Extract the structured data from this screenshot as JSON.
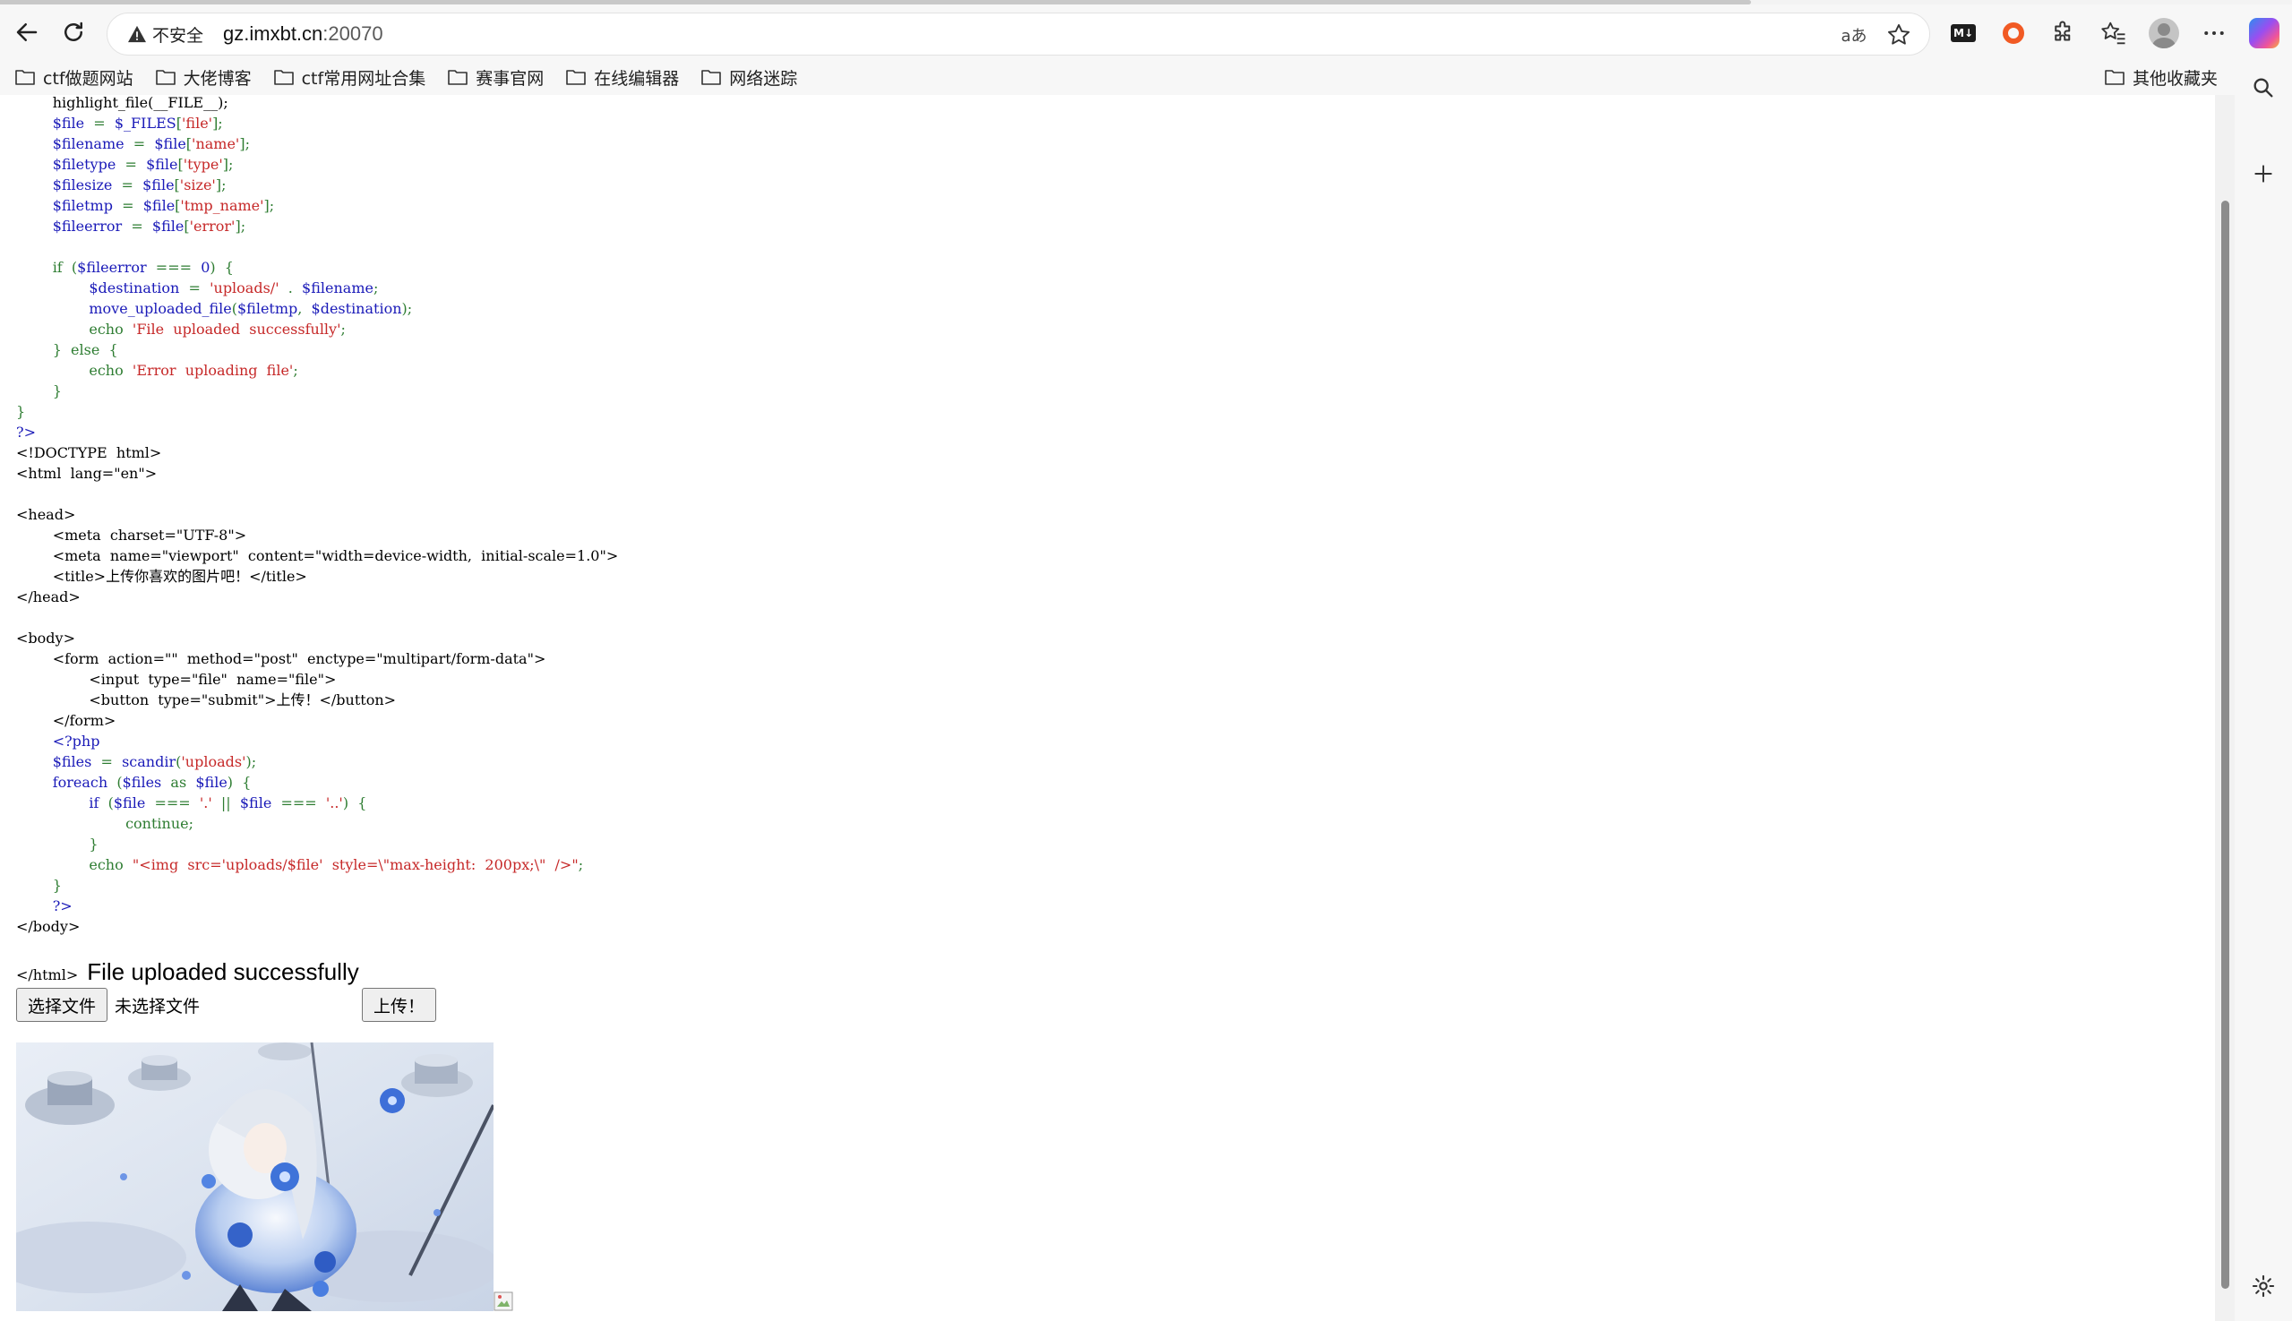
{
  "browser": {
    "security_label": "不安全",
    "url_host": "gz.imxbt.cn",
    "url_port": ":20070",
    "read_aloud_label": "aあ"
  },
  "bookmarks": [
    {
      "label": "ctf做题网站"
    },
    {
      "label": "大佬博客"
    },
    {
      "label": "ctf常用网址合集"
    },
    {
      "label": "赛事官网"
    },
    {
      "label": "在线编辑器"
    },
    {
      "label": "网络迷踪"
    }
  ],
  "other_bookmarks_label": "其他收藏夹",
  "source_lines": [
    [
      [
        "h",
        "        highlight_file(__FILE__);"
      ]
    ],
    [
      [
        "h",
        "        "
      ],
      [
        "v",
        "$file"
      ],
      [
        "k",
        "  =  "
      ],
      [
        "v",
        "$_FILES"
      ],
      [
        "k",
        "["
      ],
      [
        "s",
        "'file'"
      ],
      [
        "k",
        "];"
      ]
    ],
    [
      [
        "h",
        "        "
      ],
      [
        "v",
        "$filename"
      ],
      [
        "k",
        "  =  "
      ],
      [
        "v",
        "$file"
      ],
      [
        "k",
        "["
      ],
      [
        "s",
        "'name'"
      ],
      [
        "k",
        "];"
      ]
    ],
    [
      [
        "h",
        "        "
      ],
      [
        "v",
        "$filetype"
      ],
      [
        "k",
        "  =  "
      ],
      [
        "v",
        "$file"
      ],
      [
        "k",
        "["
      ],
      [
        "s",
        "'type'"
      ],
      [
        "k",
        "];"
      ]
    ],
    [
      [
        "h",
        "        "
      ],
      [
        "v",
        "$filesize"
      ],
      [
        "k",
        "  =  "
      ],
      [
        "v",
        "$file"
      ],
      [
        "k",
        "["
      ],
      [
        "s",
        "'size'"
      ],
      [
        "k",
        "];"
      ]
    ],
    [
      [
        "h",
        "        "
      ],
      [
        "v",
        "$filetmp"
      ],
      [
        "k",
        "  =  "
      ],
      [
        "v",
        "$file"
      ],
      [
        "k",
        "["
      ],
      [
        "s",
        "'tmp_name'"
      ],
      [
        "k",
        "];"
      ]
    ],
    [
      [
        "h",
        "        "
      ],
      [
        "v",
        "$fileerror"
      ],
      [
        "k",
        "  =  "
      ],
      [
        "v",
        "$file"
      ],
      [
        "k",
        "["
      ],
      [
        "s",
        "'error'"
      ],
      [
        "k",
        "];"
      ]
    ],
    [
      [
        "h",
        ""
      ]
    ],
    [
      [
        "h",
        "        "
      ],
      [
        "k",
        "if  ("
      ],
      [
        "v",
        "$fileerror"
      ],
      [
        "k",
        "  ===  "
      ],
      [
        "v",
        "0"
      ],
      [
        "k",
        ")  {"
      ]
    ],
    [
      [
        "h",
        "                "
      ],
      [
        "v",
        "$destination"
      ],
      [
        "k",
        "  =  "
      ],
      [
        "s",
        "'uploads/'"
      ],
      [
        "k",
        "  .  "
      ],
      [
        "v",
        "$filename"
      ],
      [
        "k",
        ";"
      ]
    ],
    [
      [
        "h",
        "                "
      ],
      [
        "v",
        "move_uploaded_file"
      ],
      [
        "k",
        "("
      ],
      [
        "v",
        "$filetmp"
      ],
      [
        "k",
        ",  "
      ],
      [
        "v",
        "$destination"
      ],
      [
        "k",
        ");"
      ]
    ],
    [
      [
        "h",
        "                "
      ],
      [
        "k",
        "echo  "
      ],
      [
        "s",
        "'File  uploaded  successfully'"
      ],
      [
        "k",
        ";"
      ]
    ],
    [
      [
        "h",
        "        "
      ],
      [
        "k",
        "}  else  {"
      ]
    ],
    [
      [
        "h",
        "                "
      ],
      [
        "k",
        "echo  "
      ],
      [
        "s",
        "'Error  uploading  file'"
      ],
      [
        "k",
        ";"
      ]
    ],
    [
      [
        "h",
        "        "
      ],
      [
        "k",
        "}"
      ]
    ],
    [
      [
        "k",
        "}"
      ]
    ],
    [
      [
        "v",
        "?>"
      ]
    ],
    [
      [
        "h",
        "<!DOCTYPE  html>"
      ]
    ],
    [
      [
        "h",
        "<html  lang=\"en\">"
      ]
    ],
    [
      [
        "h",
        ""
      ]
    ],
    [
      [
        "h",
        "<head>"
      ]
    ],
    [
      [
        "h",
        "        <meta  charset=\"UTF-8\">"
      ]
    ],
    [
      [
        "h",
        "        <meta  name=\"viewport\"  content=\"width=device-width,  initial-scale=1.0\">"
      ]
    ],
    [
      [
        "h",
        "        <title>上传你喜欢的图片吧！</title>"
      ]
    ],
    [
      [
        "h",
        "</head>"
      ]
    ],
    [
      [
        "h",
        ""
      ]
    ],
    [
      [
        "h",
        "<body>"
      ]
    ],
    [
      [
        "h",
        "        <form  action=\"\"  method=\"post\"  enctype=\"multipart/form-data\">"
      ]
    ],
    [
      [
        "h",
        "                <input  type=\"file\"  name=\"file\">"
      ]
    ],
    [
      [
        "h",
        "                <button  type=\"submit\">上传！</button>"
      ]
    ],
    [
      [
        "h",
        "        </form>"
      ]
    ],
    [
      [
        "h",
        "        "
      ],
      [
        "v",
        "<?php"
      ]
    ],
    [
      [
        "h",
        "        "
      ],
      [
        "v",
        "$files"
      ],
      [
        "k",
        "  =  "
      ],
      [
        "v",
        "scandir"
      ],
      [
        "k",
        "("
      ],
      [
        "s",
        "'uploads'"
      ],
      [
        "k",
        ");"
      ]
    ],
    [
      [
        "h",
        "        "
      ],
      [
        "v",
        "foreach"
      ],
      [
        "k",
        "  ("
      ],
      [
        "v",
        "$files"
      ],
      [
        "k",
        "  as  "
      ],
      [
        "v",
        "$file"
      ],
      [
        "k",
        ")  {"
      ]
    ],
    [
      [
        "h",
        "                "
      ],
      [
        "v",
        "if"
      ],
      [
        "k",
        "  ("
      ],
      [
        "v",
        "$file"
      ],
      [
        "k",
        "  ===  "
      ],
      [
        "s",
        "'.'"
      ],
      [
        "k",
        "  ||  "
      ],
      [
        "v",
        "$file"
      ],
      [
        "k",
        "  ===  "
      ],
      [
        "s",
        "'..'"
      ],
      [
        "k",
        ")  {"
      ]
    ],
    [
      [
        "h",
        "                        "
      ],
      [
        "k",
        "continue;"
      ]
    ],
    [
      [
        "h",
        "                "
      ],
      [
        "k",
        "}"
      ]
    ],
    [
      [
        "h",
        "                "
      ],
      [
        "k",
        "echo  "
      ],
      [
        "s",
        "\"<img  src='uploads/$file'  style=\\\"max-height:  200px;\\\"  />\""
      ],
      [
        "k",
        ";"
      ]
    ],
    [
      [
        "h",
        "        "
      ],
      [
        "k",
        "}"
      ]
    ],
    [
      [
        "h",
        "        "
      ],
      [
        "v",
        "?>"
      ]
    ],
    [
      [
        "h",
        "</body>"
      ]
    ],
    [
      [
        "h",
        ""
      ]
    ]
  ],
  "result": {
    "close_tag": "</html>",
    "message": "File uploaded successfully"
  },
  "form": {
    "choose_file_label": "选择文件",
    "no_file_label": "未选择文件",
    "submit_label": "上传！"
  }
}
